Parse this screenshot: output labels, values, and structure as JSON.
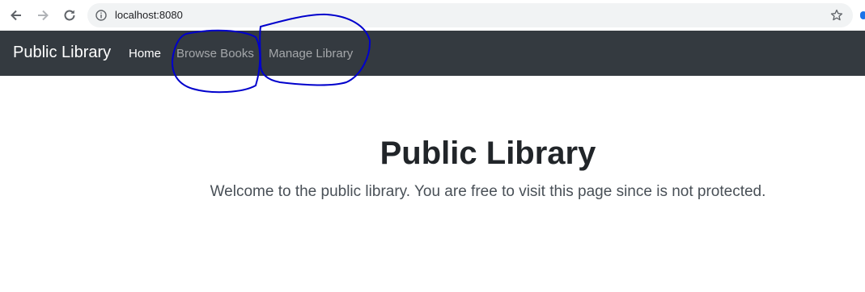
{
  "browser": {
    "url": "localhost:8080",
    "icons": {
      "back": "arrow-left-icon",
      "forward": "arrow-right-icon",
      "reload": "reload-icon",
      "info": "info-icon",
      "bookmark": "star-icon"
    }
  },
  "navbar": {
    "brand": "Public Library",
    "links": [
      {
        "label": "Home",
        "active": true
      },
      {
        "label": "Browse Books",
        "active": false
      },
      {
        "label": "Manage Library",
        "active": false
      }
    ],
    "background": "#343a40"
  },
  "main": {
    "title": "Public Library",
    "lead": "Welcome to the public library. You are free to visit this page since is not protected."
  },
  "colors": {
    "annotation": "#0000cc"
  }
}
